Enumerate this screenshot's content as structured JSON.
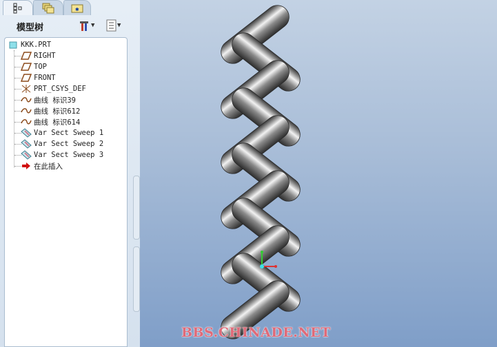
{
  "tabs": [
    {
      "name": "model-tree-tab",
      "icon": "tree-icon"
    },
    {
      "name": "folder-browser-tab",
      "icon": "folders-icon"
    },
    {
      "name": "favorites-tab",
      "icon": "star-folder-icon"
    }
  ],
  "panel": {
    "title": "模型树",
    "settings_icon": "tools-icon",
    "show_icon": "list-icon"
  },
  "tree": {
    "root": "KKK.PRT",
    "items": [
      {
        "label": "RIGHT",
        "icon": "datum-plane-icon"
      },
      {
        "label": "TOP",
        "icon": "datum-plane-icon"
      },
      {
        "label": "FRONT",
        "icon": "datum-plane-icon"
      },
      {
        "label": "PRT_CSYS_DEF",
        "icon": "csys-icon"
      },
      {
        "label": "曲线 标识39",
        "icon": "curve-icon"
      },
      {
        "label": "曲线 标识612",
        "icon": "curve-icon"
      },
      {
        "label": "曲线 标识614",
        "icon": "curve-icon"
      },
      {
        "label": "Var Sect Sweep 1",
        "icon": "sweep-icon"
      },
      {
        "label": "Var Sect Sweep 2",
        "icon": "sweep-icon"
      },
      {
        "label": "Var Sect Sweep 3",
        "icon": "sweep-icon"
      },
      {
        "label": "在此插入",
        "icon": "insert-arrow-icon"
      }
    ]
  },
  "watermark": "BBS.CHINADE.NET"
}
